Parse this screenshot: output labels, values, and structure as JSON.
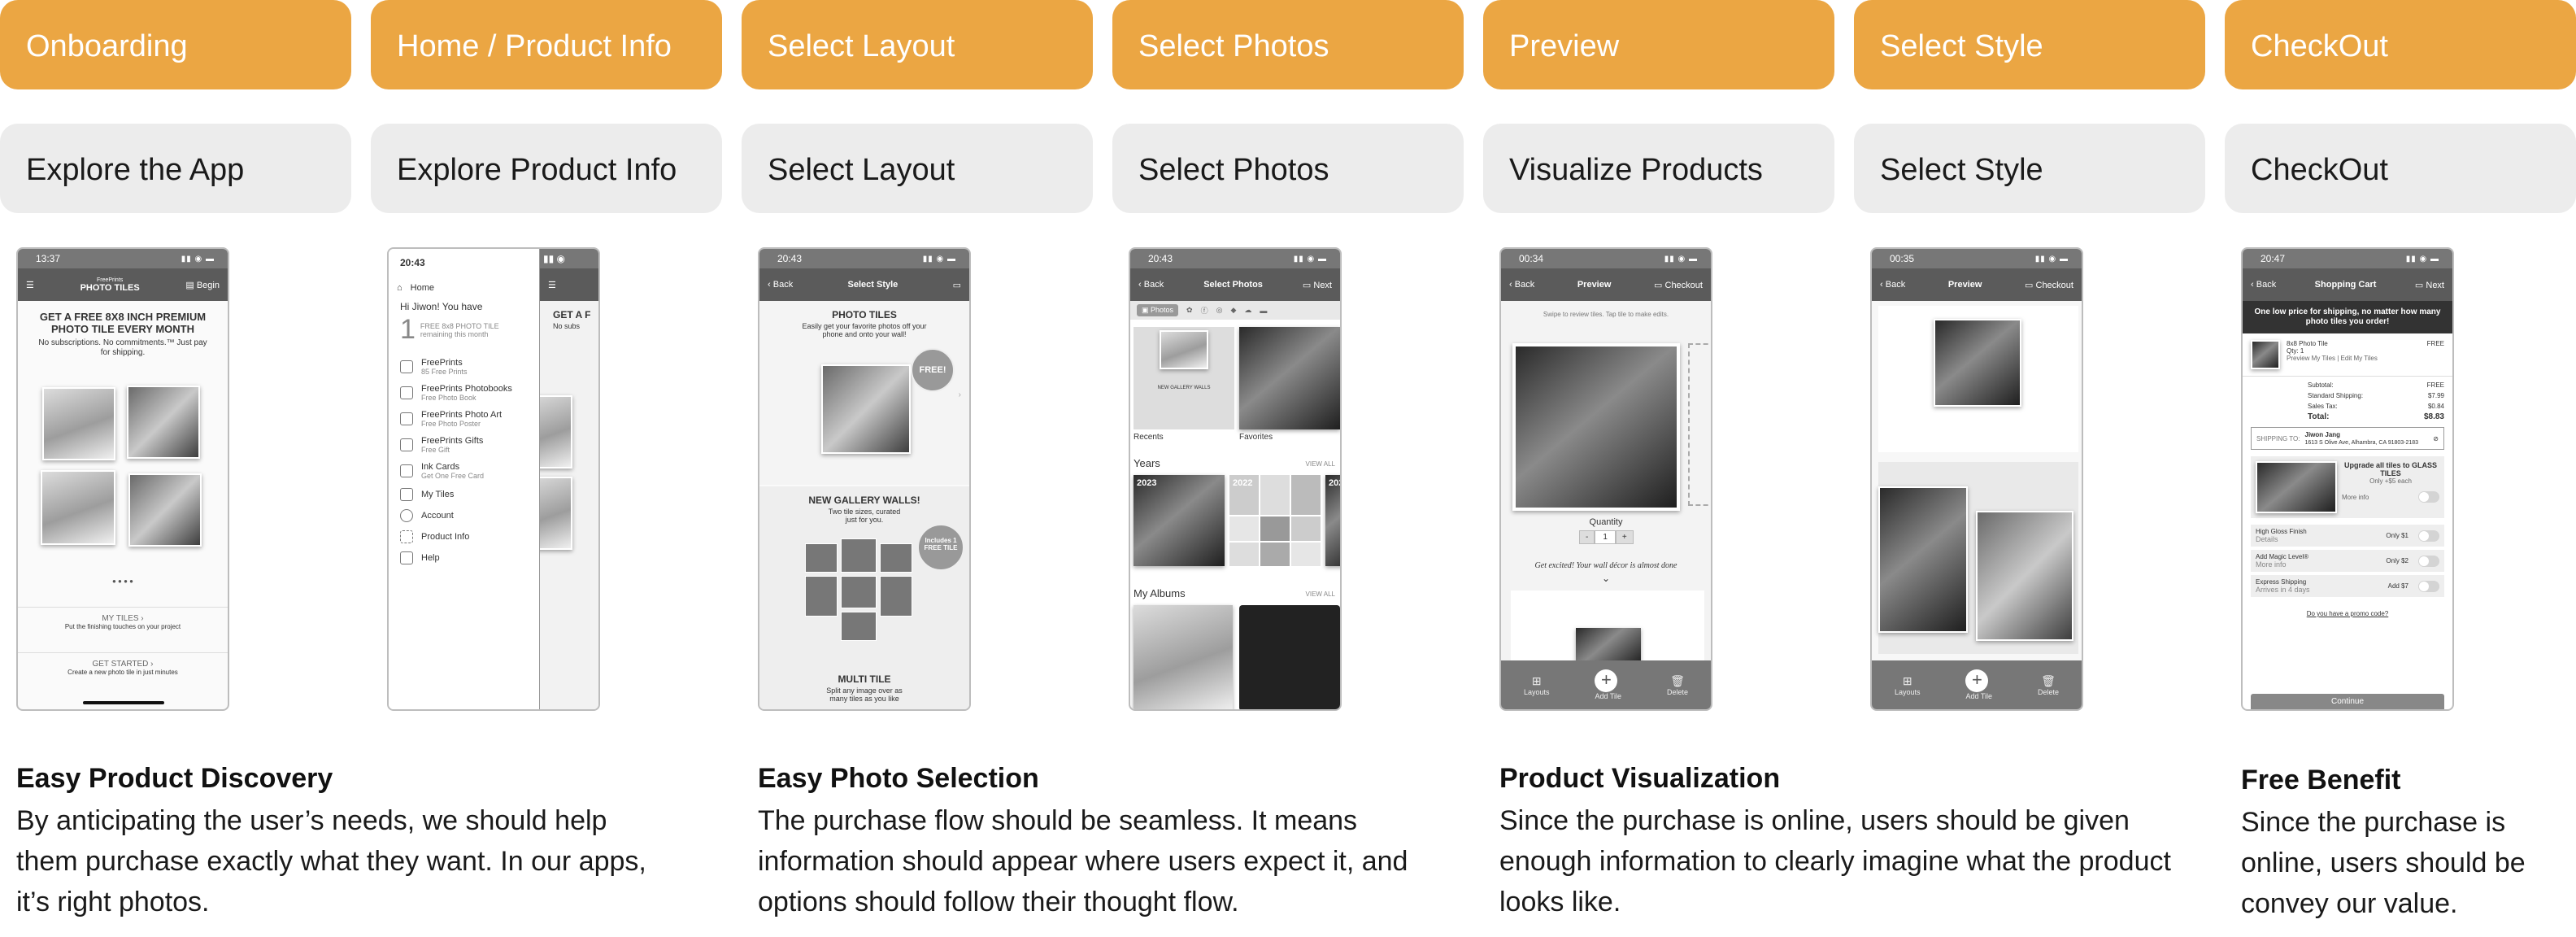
{
  "stages": [
    "Onboarding",
    "Home / Product Info",
    "Select Layout",
    "Select Photos",
    "Preview",
    "Select Style",
    "CheckOut"
  ],
  "steps": [
    "Explore the App",
    "Explore Product Info",
    "Select Layout",
    "Select Photos",
    "Visualize Products",
    "Select Style",
    "CheckOut"
  ],
  "summaries": [
    {
      "title": "Easy Product Discovery",
      "text": "By anticipating the user’s needs, we should help them purchase exactly what they want. In our apps, it’s right photos."
    },
    {
      "title": "Easy Photo Selection",
      "text": "The purchase flow should be seamless. It means information should appear where users expect it, and options should follow their thought flow."
    },
    {
      "title": "Product Visualization",
      "text": "Since the purchase is online, users should be given enough information to clearly imagine what the product looks like."
    },
    {
      "title": "Free Benefit",
      "text": "Since the purchase is online, users should be convey our value."
    }
  ],
  "screens": {
    "onboarding": {
      "time": "13:37",
      "logo_top": "FreePrints",
      "logo": "PHOTO TILES",
      "begin": "Begin",
      "headline": "GET A FREE 8X8 INCH PREMIUM PHOTO TILE EVERY MONTH",
      "subline": "No subscriptions. No commitments.™ Just pay for shipping.",
      "my_tiles": "MY TILES ›",
      "my_tiles_sub": "Put the finishing touches on your project",
      "get_started": "GET STARTED ›",
      "get_started_sub": "Create a new photo tile in just minutes"
    },
    "home": {
      "time": "20:43",
      "greeting": "Hi Jiwon! You have",
      "big_number": "1",
      "free_tile": "FREE 8x8 PHOTO TILE",
      "remaining": "remaining this month",
      "menu": [
        {
          "label": "Home",
          "sub": ""
        },
        {
          "label": "FreePrints",
          "sub": "85 Free Prints"
        },
        {
          "label": "FreePrints Photobooks",
          "sub": "Free Photo Book"
        },
        {
          "label": "FreePrints Photo Art",
          "sub": "Free Photo Poster"
        },
        {
          "label": "FreePrints Gifts",
          "sub": "Free Gift"
        },
        {
          "label": "Ink Cards",
          "sub": "Get One Free Card"
        },
        {
          "label": "My Tiles",
          "sub": ""
        },
        {
          "label": "Account",
          "sub": ""
        },
        {
          "label": "Product Info",
          "sub": ""
        },
        {
          "label": "Help",
          "sub": ""
        }
      ],
      "peek_head": "GET A F",
      "peek_sub": "No subs"
    },
    "layout": {
      "time": "20:43",
      "back": "Back",
      "title": "Select Style",
      "card1_title": "PHOTO TILES",
      "card1_sub": "Easily get your favorite photos off your phone and onto your wall!",
      "free": "FREE!",
      "card2_title": "NEW GALLERY WALLS!",
      "card2_sub": "Two tile sizes, curated just for you.",
      "includes": "Includes 1 FREE TILE",
      "card3_title": "MULTI TILE",
      "card3_sub": "Split any image over as many tiles as you like"
    },
    "photos": {
      "time": "20:43",
      "back": "Back",
      "title": "Select Photos",
      "next": "Next",
      "tab": "Photos",
      "recents": "Recents",
      "favorites": "Favorites",
      "years": "Years",
      "view_all": "VIEW ALL",
      "year1": "2023",
      "year2": "2022",
      "year3": "202",
      "albums": "My Albums",
      "view_all2": "VIEW ALL",
      "album_label": "NEW GALLERY WALLS"
    },
    "preview": {
      "time": "00:34",
      "back": "Back",
      "title": "Preview",
      "checkout": "Checkout",
      "hint": "Swipe to review tiles. Tap tile to make edits.",
      "quantity": "Quantity",
      "qty": "1",
      "minus": "-",
      "plus": "+",
      "script": "Get excited! Your wall décor is almost done",
      "b1": "Layouts",
      "b2": "Add Tile",
      "b3": "Delete"
    },
    "style": {
      "time": "00:35",
      "back": "Back",
      "title": "Preview",
      "checkout": "Checkout",
      "b1": "Layouts",
      "b2": "Add Tile",
      "b3": "Delete"
    },
    "checkout": {
      "time": "20:47",
      "back": "Back",
      "title": "Shopping Cart",
      "next": "Next",
      "banner": "One low price for shipping, no matter how many photo tiles you order!",
      "item": "8x8 Photo Tile",
      "item_qty": "Qty: 1",
      "item_free": "FREE",
      "item_links": "Preview My Tiles | Edit My Tiles",
      "rows": [
        {
          "label": "Subtotal:",
          "value": "FREE"
        },
        {
          "label": "Standard Shipping:",
          "value": "$7.99"
        },
        {
          "label": "Sales Tax:",
          "value": "$0.84"
        },
        {
          "label": "Total:",
          "value": "$8.83"
        }
      ],
      "ship_to": "SHIPPING TO:",
      "ship_name": "Jiwon Jang",
      "ship_addr": "1613 S Olive Ave, Alhambra, CA 91803-2183",
      "upgrade": "Upgrade all tiles to GLASS TILES",
      "upgrade_price": "Only +$5 each",
      "more_info": "More info",
      "options": [
        {
          "label": "High Gloss Finish",
          "sub": "Details",
          "price": "Only $1"
        },
        {
          "label": "Add Magic Level®",
          "sub": "More info",
          "price": "Only $2"
        },
        {
          "label": "Express Shipping",
          "sub": "Arrives in 4 days",
          "price": "Add $7"
        }
      ],
      "promo": "Do you have a promo code?",
      "continue": "Continue"
    }
  }
}
